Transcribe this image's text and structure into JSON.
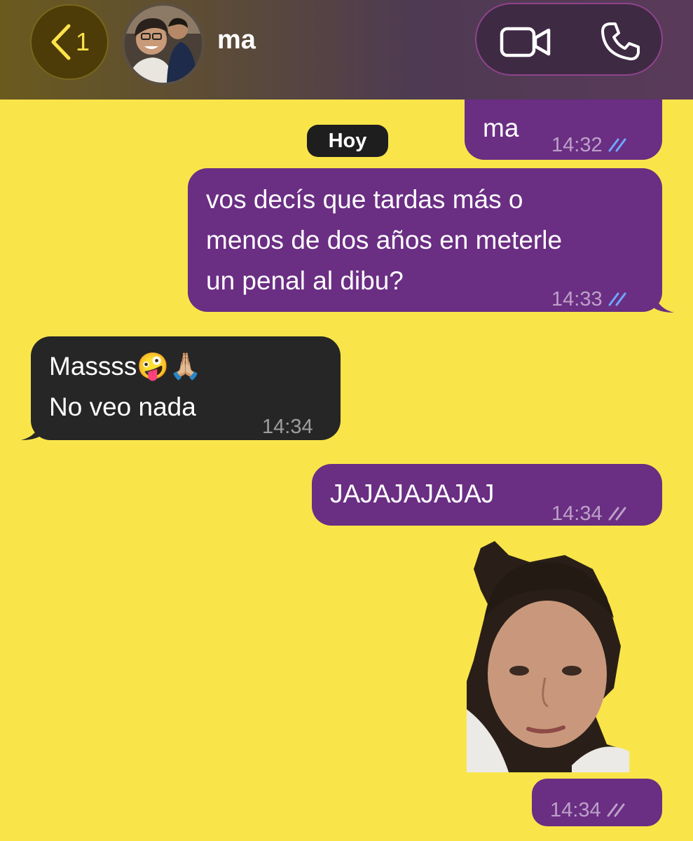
{
  "header": {
    "back_count": "1",
    "contact_name": "ma",
    "icons": [
      "chevron-left-icon",
      "video-call-icon",
      "phone-call-icon"
    ]
  },
  "date_separator": "Hoy",
  "messages": [
    {
      "direction": "out",
      "text_lines": [
        "ma"
      ],
      "time": "14:32",
      "status": "read"
    },
    {
      "direction": "out",
      "text_lines": [
        "vos decís que tardas más o",
        "menos de dos años en meterle",
        "un penal al dibu?"
      ],
      "time": "14:33",
      "status": "read"
    },
    {
      "direction": "in",
      "text_lines": [
        "Massss🤪🙏🏼",
        "No veo nada"
      ],
      "time": "14:34"
    },
    {
      "direction": "out",
      "text_lines": [
        "JAJAJAJAJAJ"
      ],
      "time": "14:34",
      "status": "delivered"
    },
    {
      "direction": "out",
      "type": "sticker",
      "time": "14:34",
      "status": "delivered"
    }
  ],
  "colors": {
    "chat_background": "#f9e54a",
    "outgoing_bubble": "#6a2e83",
    "incoming_bubble": "#262626",
    "read_check": "#6fa8ff",
    "accent": "#ffe34a"
  }
}
